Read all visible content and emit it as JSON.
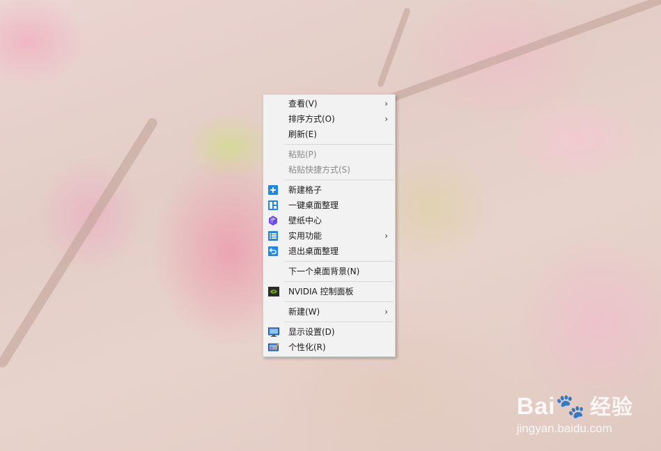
{
  "menu": {
    "items": [
      {
        "label": "查看(V)",
        "submenu": true
      },
      {
        "label": "排序方式(O)",
        "submenu": true
      },
      {
        "label": "刷新(E)"
      },
      {
        "label": "粘贴(P)",
        "disabled": true
      },
      {
        "label": "粘贴快捷方式(S)",
        "disabled": true
      },
      {
        "label": "新建格子",
        "icon": "plus-square-icon"
      },
      {
        "label": "一键桌面整理",
        "icon": "layout-grid-icon"
      },
      {
        "label": "壁纸中心",
        "icon": "cube-icon"
      },
      {
        "label": "实用功能",
        "icon": "list-icon",
        "submenu": true
      },
      {
        "label": "退出桌面整理",
        "icon": "undo-icon"
      },
      {
        "label": "下一个桌面背景(N)"
      },
      {
        "label": "NVIDIA 控制面板",
        "icon": "nvidia-icon"
      },
      {
        "label": "新建(W)",
        "submenu": true
      },
      {
        "label": "显示设置(D)",
        "icon": "monitor-icon"
      },
      {
        "label": "个性化(R)",
        "icon": "personalize-icon"
      }
    ],
    "submenu_glyph": "›",
    "accent": "#1e88e5",
    "icon_purple": "#6c4ce0",
    "nvidia_green": "#76b900"
  },
  "watermark": {
    "brand": "Bai",
    "brand_zh": "经验",
    "url": "jingyan.baidu.com"
  }
}
